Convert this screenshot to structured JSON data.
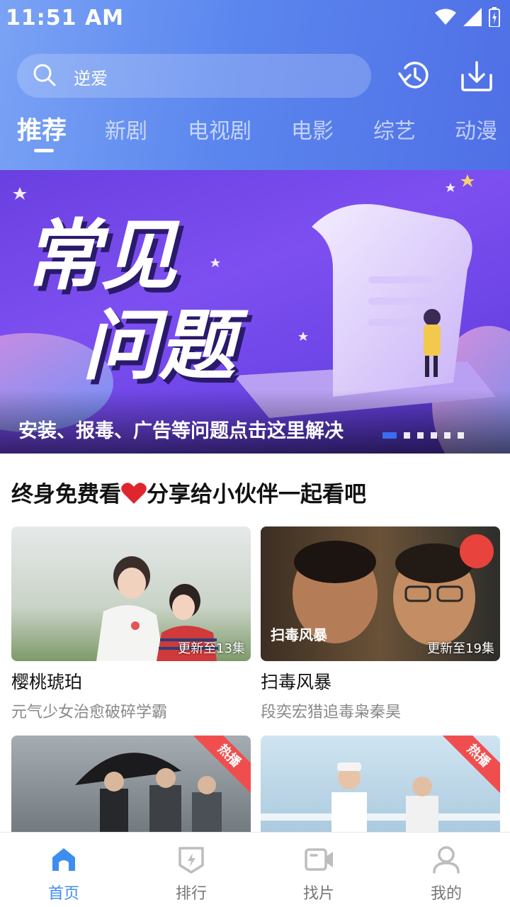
{
  "status": {
    "time": "11:51 AM"
  },
  "search": {
    "query": "逆爱"
  },
  "tabs": [
    "推荐",
    "新剧",
    "电视剧",
    "电影",
    "综艺",
    "动漫"
  ],
  "banner": {
    "title_line1": "常见",
    "title_line2": "问题",
    "caption": "安装、报毒、广告等问题点击这里解决",
    "dot_count": 6,
    "active_dot": 0
  },
  "section": {
    "title_part1": "终身免费看",
    "title_part2": "分享给小伙伴一起看吧"
  },
  "cards": [
    {
      "title": "樱桃琥珀",
      "subtitle": "元气少女治愈破碎学霸",
      "badge": "更新至13集"
    },
    {
      "title": "扫毒风暴",
      "subtitle": "段奕宏猎追毒枭秦昊",
      "badge": "更新至19集"
    },
    {
      "ribbon": "热播"
    },
    {
      "ribbon": "热播"
    }
  ],
  "nav": [
    {
      "label": "首页",
      "icon": "home-icon"
    },
    {
      "label": "排行",
      "icon": "ranking-icon"
    },
    {
      "label": "找片",
      "icon": "video-icon"
    },
    {
      "label": "我的",
      "icon": "user-icon"
    }
  ],
  "colors": {
    "accent": "#3d8ef0",
    "hot": "#f04e4e",
    "header": "#5b86ee",
    "banner": "#6a3fe0"
  }
}
